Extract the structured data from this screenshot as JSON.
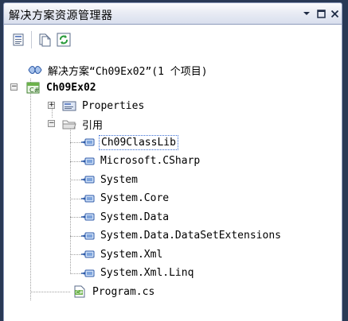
{
  "window": {
    "title": "解决方案资源管理器",
    "dropdown_icon": "dropdown-arrow-icon",
    "restore_icon": "restore-icon",
    "close_icon": "close-icon"
  },
  "toolbar": {
    "buttons": [
      {
        "icon": "properties-icon"
      },
      {
        "icon": "show-all-files-icon"
      },
      {
        "icon": "refresh-icon"
      }
    ]
  },
  "tree": {
    "solution_label": "解决方案“Ch09Ex02”(1 个项目)",
    "project_label": "Ch09Ex02",
    "properties_label": "Properties",
    "references_label": "引用",
    "references": [
      "Ch09ClassLib",
      "Microsoft.CSharp",
      "System",
      "System.Core",
      "System.Data",
      "System.Data.DataSetExtensions",
      "System.Xml",
      "System.Xml.Linq"
    ],
    "selected_reference": "Ch09ClassLib",
    "program_label": "Program.cs"
  },
  "colors": {
    "frame": "#293955",
    "selection_border": "#3b6fd6"
  }
}
